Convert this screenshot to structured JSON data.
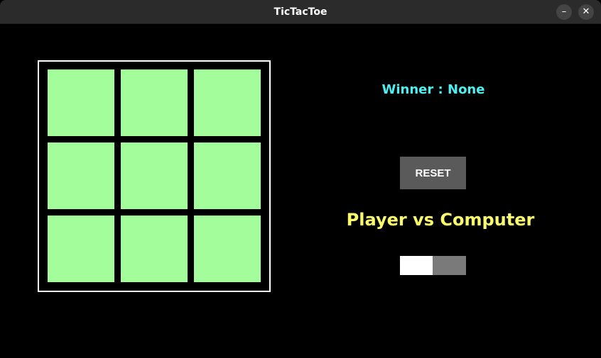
{
  "window": {
    "title": "TicTacToe",
    "minimize_glyph": "–",
    "close_glyph": "✕",
    "minimize_icon": "minimize-icon",
    "close_icon": "close-icon"
  },
  "board": {
    "cells": [
      "",
      "",
      "",
      "",
      "",
      "",
      "",
      "",
      ""
    ],
    "cell_color": "#a3fd9a",
    "border_color": "#ffffff"
  },
  "status": {
    "winner_text": "Winner : None",
    "winner_color": "#4cf0f0"
  },
  "controls": {
    "reset_label": "RESET",
    "mode_label": "Player vs Computer",
    "mode_color": "#fbfc6c",
    "toggle_on": false
  }
}
